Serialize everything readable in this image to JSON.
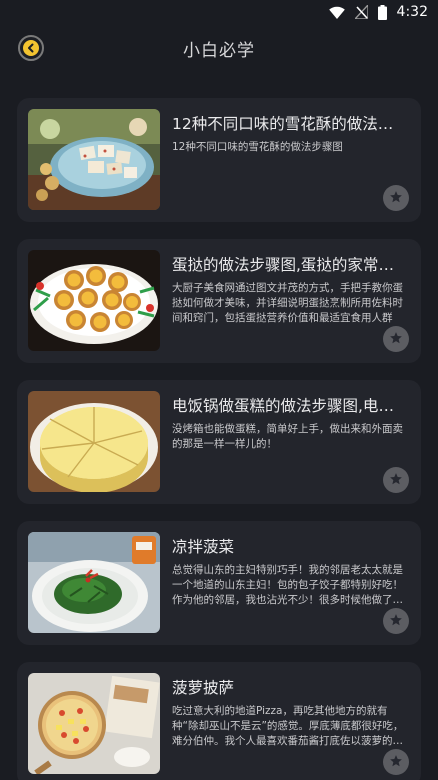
{
  "status": {
    "time": "4:32",
    "icons": [
      "wifi-icon",
      "no-signal-icon",
      "battery-icon"
    ]
  },
  "header": {
    "back_icon": "chevron-left-icon",
    "title": "小白必学"
  },
  "colors": {
    "background": "#1a1c22",
    "card": "#23252c",
    "accent": "#f4c430"
  },
  "recipes": [
    {
      "title": "12种不同口味的雪花酥的做法步骤图",
      "desc": "12种不同口味的雪花酥的做法步骤图",
      "image": "snowflake-crisp-photo",
      "fav_icon": "star-icon"
    },
    {
      "title": "蛋挞的做法步骤图,蛋挞的家常做法",
      "desc": "大厨子美食网通过图文并茂的方式，手把手教你蛋挞如何做才美味，并详细说明蛋挞烹制所用佐料时间和窍门，包括蛋挞营养价值和最适宜食用人群",
      "image": "egg-tarts-photo",
      "fav_icon": "star-icon"
    },
    {
      "title": "电饭锅做蛋糕的做法步骤图,电饭锅做蛋糕",
      "desc": "没烤箱也能做蛋糕，简单好上手，做出来和外面卖的那是一样一样儿的！",
      "image": "rice-cooker-cake-photo",
      "fav_icon": "star-icon"
    },
    {
      "title": "凉拌菠菜",
      "desc": "总觉得山东的主妇特别巧手！我的邻居老太太就是一个地道的山东主妇！包的包子饺子都特别好吃！作为他的邻居，我也沾光不少！很多时候他做了好吃的都会送给我们",
      "image": "spinach-salad-photo",
      "fav_icon": "star-icon"
    },
    {
      "title": "菠萝披萨",
      "desc": "吃过意大利的地道Pizza，再吃其他地方的就有种“除却巫山不是云”的感觉。厚底薄底都很好吃，难分伯仲。我个人最喜欢番茄酱打底佐以菠萝的口味",
      "image": "pineapple-pizza-photo",
      "fav_icon": "star-icon"
    }
  ]
}
